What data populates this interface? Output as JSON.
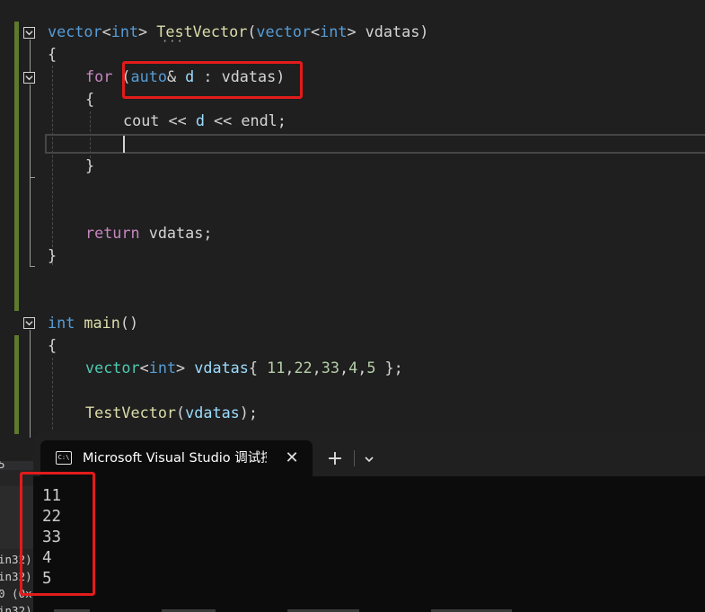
{
  "code": {
    "line1": {
      "t1": "vector",
      "t2": "<",
      "t3": "int",
      "t4": ">",
      "t5": " ",
      "t6": "TestVector",
      "t7": "(",
      "t8": "vector",
      "t9": "<",
      "t10": "int",
      "t11": ">",
      "t12": " vdatas)"
    },
    "line2": "{",
    "line3": {
      "t1": "for",
      "t2": " (",
      "t3": "auto",
      "t4": "&",
      "t5": " d",
      "t6": " : ",
      "t7": "vdatas",
      "t8": ")"
    },
    "line4": "{",
    "line5": {
      "t1": "cout",
      "t2": " << ",
      "t3": "d",
      "t4": " << ",
      "t5": "endl",
      "t6": ";"
    },
    "line7": "}",
    "line10": {
      "t1": "return",
      "t2": " vdatas;"
    },
    "line11": "}",
    "line13": {
      "t1": "int",
      "t2": " ",
      "t3": "main",
      "t4": "()"
    },
    "line14": "{",
    "line15": {
      "t1": "vector",
      "t2": "<",
      "t3": "int",
      "t4": ">",
      "t5": " ",
      "t6": "vdatas",
      "t7": "{ ",
      "t8": "11",
      "t9": ",",
      "t10": "22",
      "t11": ",",
      "t12": "33",
      "t13": ",",
      "t14": "4",
      "t15": ",",
      "t16": "5",
      "t17": " };"
    },
    "line17": {
      "t1": "TestVector",
      "t2": "(",
      "t3": "vdatas",
      "t4": ");"
    }
  },
  "terminal": {
    "tab_title": "Microsoft Visual Studio 调试控制台",
    "tab_icon_text": "C:\\",
    "close_symbol": "✕",
    "new_tab_symbol": "+",
    "output": [
      "11",
      "22",
      "33",
      "4",
      "5"
    ]
  },
  "left_panel": {
    "top_char": "5",
    "lines": [
      "in32)",
      "in32)",
      "0 (0x",
      "in32)"
    ]
  },
  "colors": {
    "highlight_box": "#e21b1b",
    "keyword": "#569cd6",
    "control": "#c586c0",
    "type": "#4ec9b0",
    "function": "#dcdcaa",
    "variable": "#9cdcfe",
    "number": "#b5cea8",
    "changed_bar": "#5d7a2d",
    "terminal_bg": "#0c0c0c"
  }
}
